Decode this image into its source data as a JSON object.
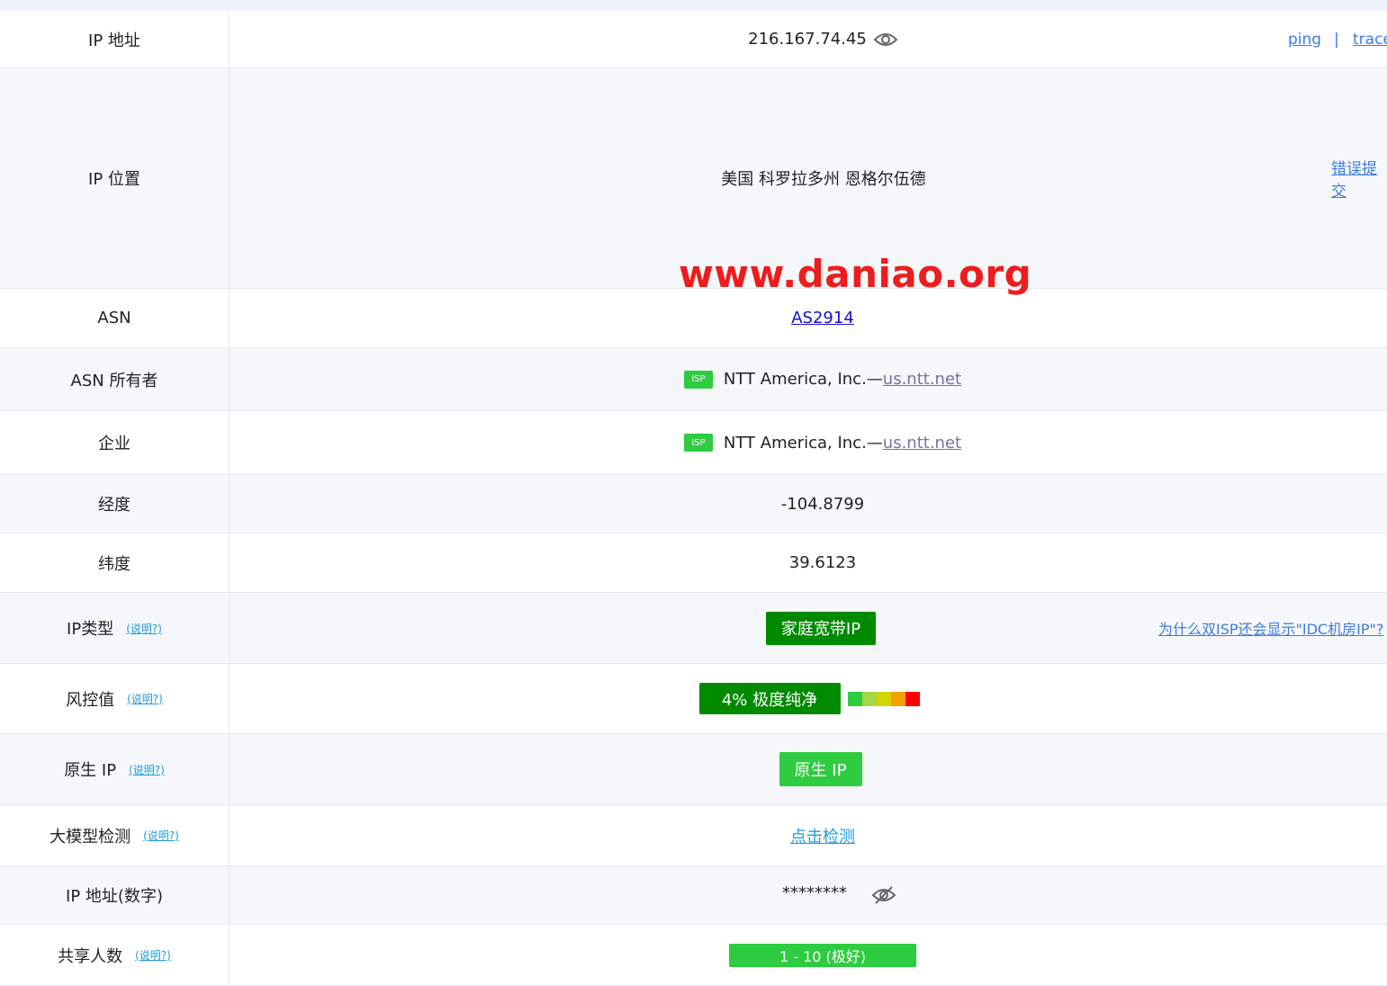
{
  "rows": {
    "ip": {
      "label": "IP 地址",
      "value": "216.167.74.45",
      "link_ping": "ping",
      "separator": "|",
      "link_trace": "trace"
    },
    "location": {
      "label": "IP 位置",
      "value": "美国 科罗拉多州 恩格尔伍德",
      "report_link": "错误提交"
    },
    "asn": {
      "label": "ASN",
      "value": "AS2914"
    },
    "asn_owner": {
      "label": "ASN 所有者",
      "badge": "ISP",
      "name": "NTT America, Inc.—",
      "domain": "us.ntt.net"
    },
    "company": {
      "label": "企业",
      "badge": "ISP",
      "name": "NTT America, Inc.—",
      "domain": "us.ntt.net"
    },
    "longitude": {
      "label": "经度",
      "value": "-104.8799"
    },
    "latitude": {
      "label": "纬度",
      "value": "39.6123"
    },
    "ip_type": {
      "label": "IP类型",
      "help": "(说明?)",
      "tag": "家庭宽带IP",
      "side_link": "为什么双ISP还会显示\"IDC机房IP\"?"
    },
    "risk": {
      "label": "风控值",
      "help": "(说明?)",
      "tag": "4%  极度纯净",
      "percent": 4,
      "scale_colors": [
        "#2ecc40",
        "#a8d64a",
        "#d4d400",
        "#f5a000",
        "#ff0000"
      ]
    },
    "native_ip": {
      "label": "原生 IP",
      "help": "(说明?)",
      "tag": "原生 IP"
    },
    "llm_check": {
      "label": "大模型检测",
      "help": "(说明?)",
      "link": "点击检测"
    },
    "ip_numeric": {
      "label": "IP 地址(数字)",
      "value": "********"
    },
    "shared_users": {
      "label": "共享人数",
      "help": "(说明?)",
      "tag": "1 - 10 (极好)"
    }
  },
  "watermark": "www.daniao.org",
  "colors": {
    "green_dark": "#008a00",
    "green_light": "#2ecc40",
    "link_blue": "#3b7de0",
    "help_cyan": "#1f9be0"
  }
}
